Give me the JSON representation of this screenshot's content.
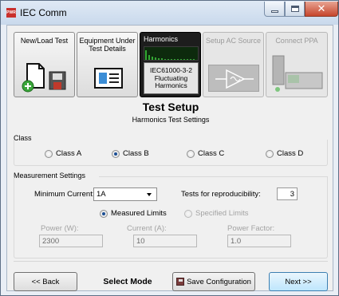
{
  "window": {
    "title": "IEC Comm",
    "icon_text": "PWR"
  },
  "steps": [
    {
      "label": "New/Load Test"
    },
    {
      "label": "Equipment Under Test Details"
    },
    {
      "label": "Harmonics",
      "standard": "IEC61000-3-2 Fluctuating Harmonics"
    },
    {
      "label": "Setup AC Source"
    },
    {
      "label": "Connect PPA"
    }
  ],
  "setup": {
    "title": "Test Setup",
    "subtitle": "Harmonics Test Settings"
  },
  "class_group": {
    "legend": "Class",
    "options": [
      "Class A",
      "Class B",
      "Class C",
      "Class D"
    ],
    "selected": "Class B"
  },
  "measurement": {
    "legend": "Measurement Settings",
    "min_current_label": "Minimum Current:",
    "min_current_value": "1A",
    "reproducibility_label": "Tests for reproducibility:",
    "reproducibility_value": "3",
    "measured_limits_label": "Measured Limits",
    "specified_limits_label": "Specified Limits",
    "power_label": "Power (W):",
    "power_value": "2300",
    "current_label": "Current (A):",
    "current_value": "10",
    "pf_label": "Power Factor:",
    "pf_value": "1.0"
  },
  "buttons": {
    "back": "<< Back",
    "select_mode": "Select Mode",
    "save": "Save Configuration",
    "next": "Next >>"
  }
}
